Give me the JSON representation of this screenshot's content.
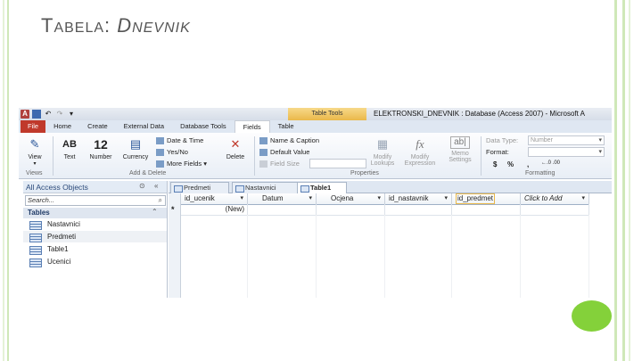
{
  "slide": {
    "title_first": "T",
    "title_rest1": "ABELA",
    "title_colon": ": ",
    "title_D": "D",
    "title_rest2": "NEVNIK"
  },
  "window": {
    "title": "ELEKTRONSKI_DNEVNIK : Database (Access 2007) - Microsoft A",
    "contextual_tab": "Table Tools",
    "app_icon_letter": "A"
  },
  "ribbon_tabs": [
    {
      "label": "File"
    },
    {
      "label": "Home"
    },
    {
      "label": "Create"
    },
    {
      "label": "External Data"
    },
    {
      "label": "Database Tools"
    },
    {
      "label": "Fields"
    },
    {
      "label": "Table"
    }
  ],
  "ribbon": {
    "views": {
      "view_label": "View",
      "group_label": "Views"
    },
    "add_delete": {
      "text_label": "Text",
      "text_icon": "AB",
      "number_label": "Number",
      "number_icon": "12",
      "currency_label": "Currency",
      "date_time_label": "Date & Time",
      "yes_no_label": "Yes/No",
      "more_fields_label": "More Fields",
      "delete_label": "Delete",
      "group_label": "Add & Delete"
    },
    "properties": {
      "name_caption_label": "Name & Caption",
      "default_value_label": "Default Value",
      "field_size_label": "Field Size",
      "modify_lookups_label1": "Modify",
      "modify_lookups_label2": "Lookups",
      "modify_expression_label1": "Modify",
      "modify_expression_label2": "Expression",
      "memo_settings_label1": "Memo",
      "memo_settings_label2": "Settings",
      "memo_icon": "ab|",
      "fx_icon": "fx",
      "group_label": "Properties"
    },
    "formatting": {
      "data_type_label": "Data Type:",
      "data_type_value": "Number",
      "format_label": "Format:",
      "currency_symbol": "$",
      "percent_symbol": "%",
      "comma_symbol": ",",
      "inc_decimals": "←.0 .00",
      "dec_decimals": ".00 →.0",
      "group_label": "Formatting"
    }
  },
  "nav_pane": {
    "header": "All Access Objects",
    "search_placeholder": "Search...",
    "group": "Tables",
    "items": [
      {
        "label": "Nastavnici"
      },
      {
        "label": "Predmeti"
      },
      {
        "label": "Table1"
      },
      {
        "label": "Ucenici"
      }
    ]
  },
  "doc_tabs": [
    {
      "label": "Predmeti"
    },
    {
      "label": "Nastavnici"
    },
    {
      "label": "Table1"
    }
  ],
  "datasheet": {
    "columns": [
      {
        "label": "id_ucenik"
      },
      {
        "label": "Datum"
      },
      {
        "label": "Ocjena"
      },
      {
        "label": "id_nastavnik"
      },
      {
        "label": "id_predmet"
      },
      {
        "label": "Click to Add"
      }
    ],
    "new_row_marker": "*",
    "new_row_value": "(New)"
  },
  "colors": {
    "slide_accent_green": "#84d13a",
    "file_tab": "#c0392b",
    "table_tools": "#eab84a"
  }
}
